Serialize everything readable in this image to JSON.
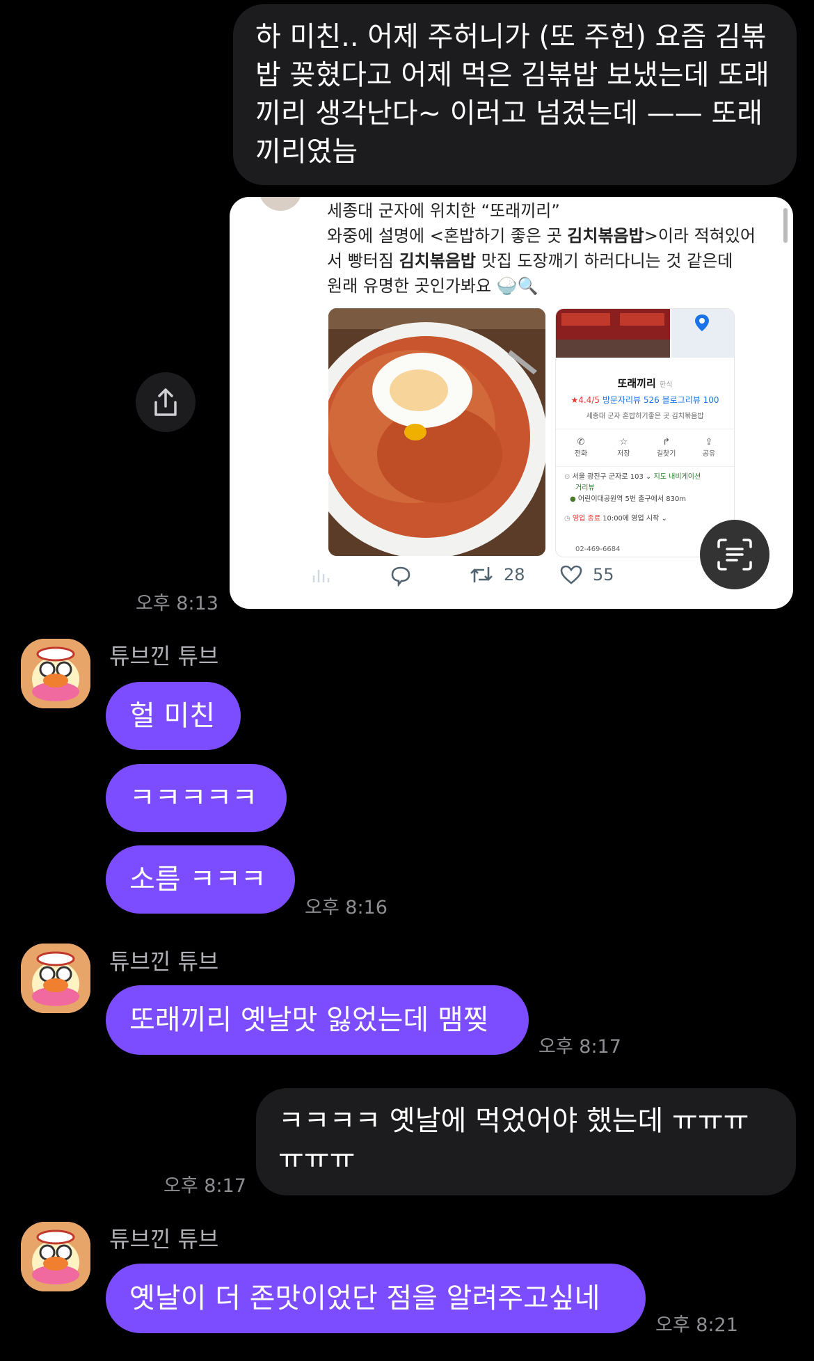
{
  "messages": {
    "m1": "하 미친.. 어제 주허니가 (또 주헌) 요즘 김볶밥 꽂혔다고 어제 먹은 김볶밥 보냈는데 또래끼리 생각난다~ 이러고 넘겼는데 —— 또래끼리였늠",
    "m1_time": "오후 8:13",
    "sender": "튜브낀 튜브",
    "m2": "헐 미친",
    "m3": "ㅋㅋㅋㅋㅋ",
    "m4": "소름 ㅋㅋㅋ",
    "m4_time": "오후 8:16",
    "m5": "또래끼리 옛날맛 잃었는데 맴찢",
    "m5_time": "오후 8:17",
    "m6": "ㅋㅋㅋㅋ 옛날에 먹었어야 했는데 ㅠㅠㅠ ㅠㅠㅠ",
    "m6_time": "오후 8:17",
    "m7": "옛날이 더 존맛이었단 점을 알려주고싶네",
    "m7_time": "오후 8:21"
  },
  "tweet": {
    "line1": "세종대 군자에 위치한 “또래끼리”",
    "line2": "와중에 설명에 <혼밥하기 좋은 곳 김치볶음밥>이라 적혀있어",
    "line3": "서 빵터짐 김치볶음밥 맛집 도장깨기 하러다니는 것 같은데",
    "line4": "원래 유명한 곳인가봐요",
    "retweets": "28",
    "likes": "55"
  },
  "place": {
    "name": "또래끼리",
    "category": "한식",
    "rating": "★4.4/5",
    "visitor_reviews": "방문자리뷰 526",
    "blog_reviews": "블로그리뷰 100",
    "desc": "세종대 군자 혼밥하기좋은 곳 김치볶음밥",
    "actions": [
      "전화",
      "저장",
      "길찾기",
      "공유"
    ],
    "address": "서울 광진구 군자로 103",
    "map_link": "지도",
    "navi_link": "내비게이션",
    "street_link": "거리뷰",
    "station": "어린이대공원역 5번 출구에서 830m",
    "hours_status": "영업 종료",
    "hours_open": "10:00에 영업 시작",
    "phone": "02-469-6684"
  },
  "colors": {
    "my_bubble": "#1c1c1e",
    "their_bubble": "#7c4dff",
    "background": "#000000"
  }
}
